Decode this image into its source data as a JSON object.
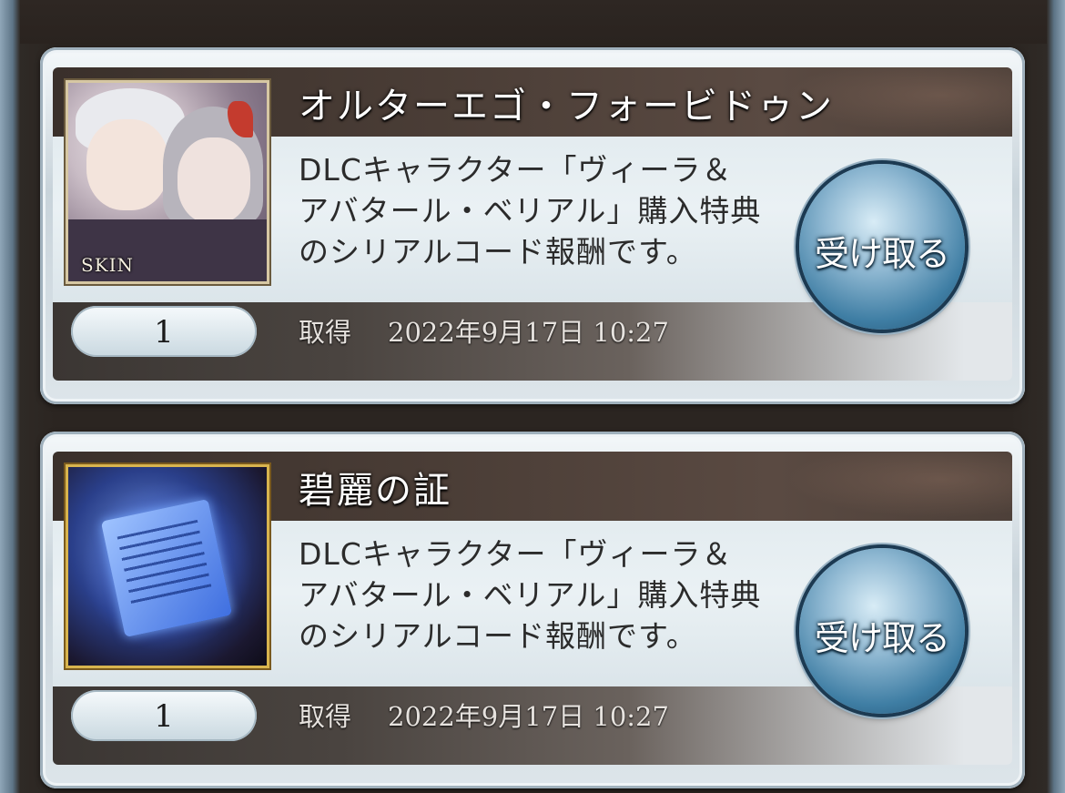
{
  "items": [
    {
      "title": "オルターエゴ・フォービドゥン",
      "thumbnail_badge": "SKIN",
      "description_lines": [
        "DLCキャラクター「ヴィーラ＆",
        "アバタール・ベリアル」購入特典",
        "のシリアルコード報酬です。"
      ],
      "count": "1",
      "acquired_label": "取得",
      "acquired_date": "2022年9月17日  10:27",
      "receive_label": "受け取る"
    },
    {
      "title": "碧麗の証",
      "description_lines": [
        "DLCキャラクター「ヴィーラ＆",
        "アバタール・ベリアル」購入特典",
        "のシリアルコード報酬です。"
      ],
      "count": "1",
      "acquired_label": "取得",
      "acquired_date": "2022年9月17日  10:27",
      "receive_label": "受け取る"
    }
  ]
}
